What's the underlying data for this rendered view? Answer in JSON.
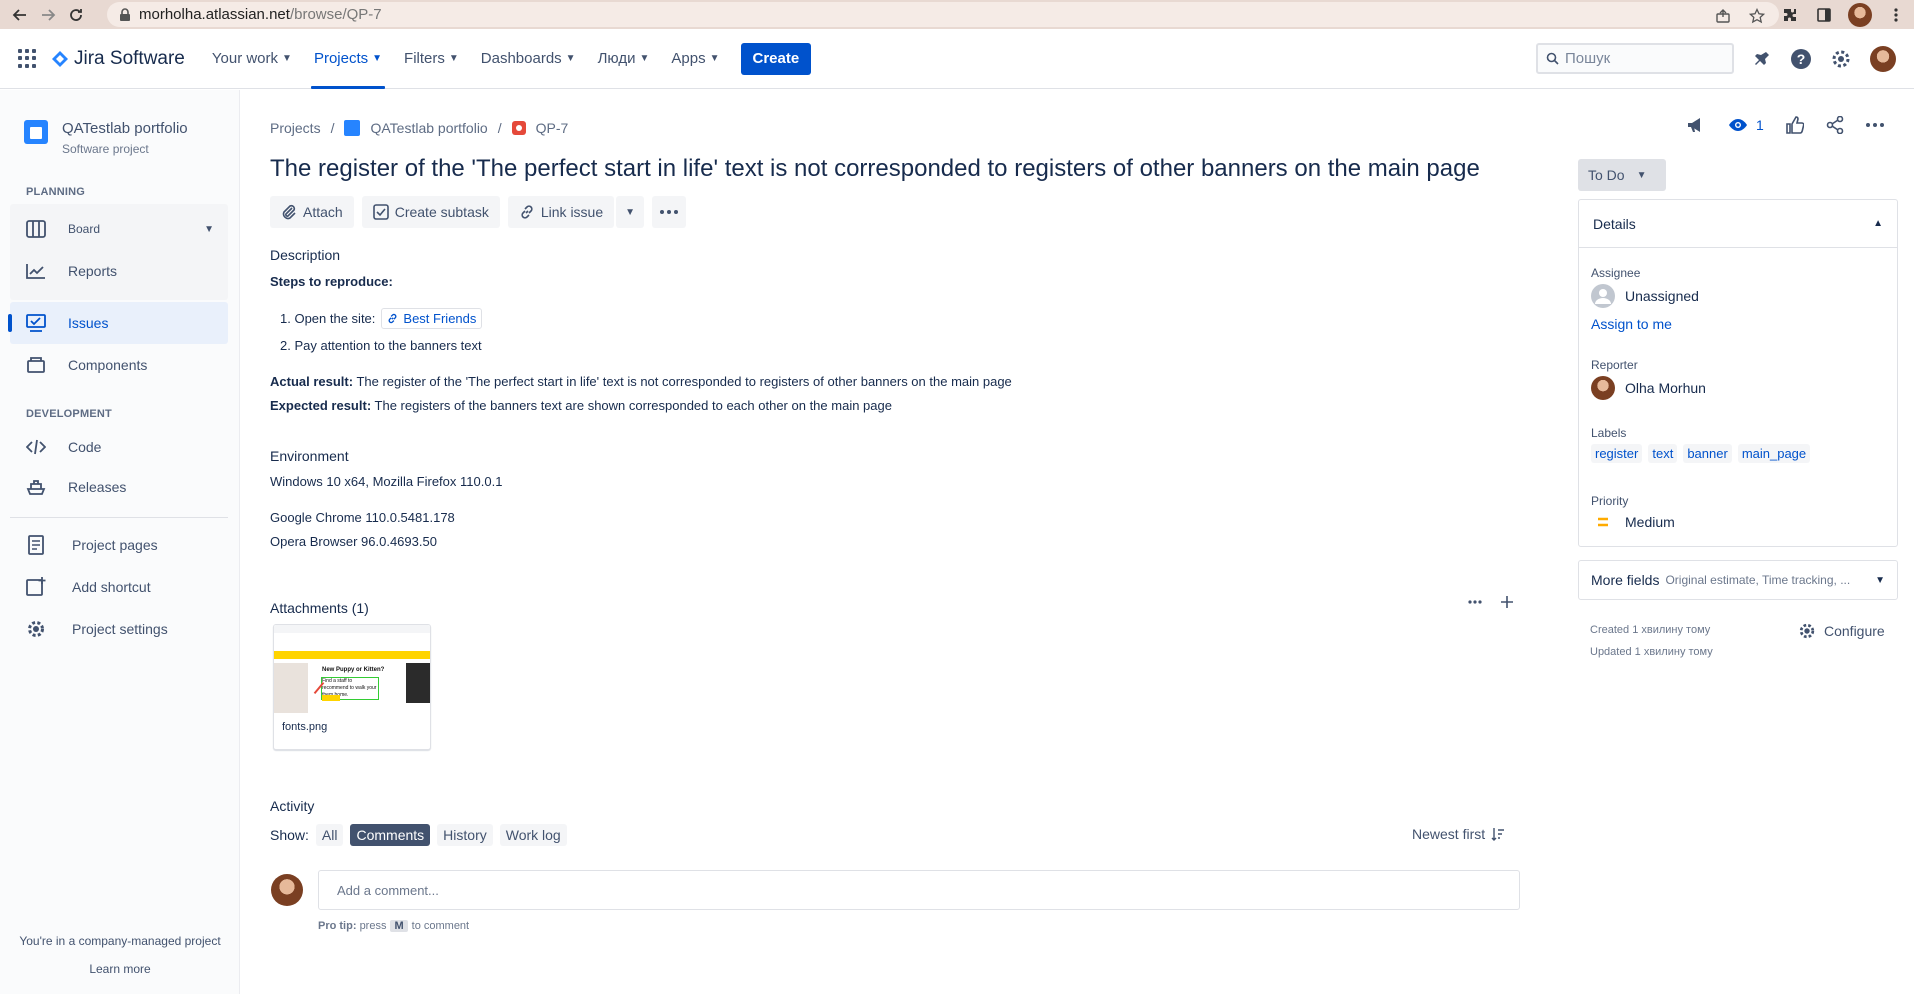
{
  "browser": {
    "url_host": "morholha.atlassian.net",
    "url_path": "/browse/QP-7"
  },
  "topnav": {
    "product": "Jira Software",
    "items": [
      {
        "label": "Your work"
      },
      {
        "label": "Projects"
      },
      {
        "label": "Filters"
      },
      {
        "label": "Dashboards"
      },
      {
        "label": "Люди"
      },
      {
        "label": "Apps"
      }
    ],
    "create_label": "Create",
    "search_placeholder": "Пошук"
  },
  "sidebar": {
    "project_name": "QATestlab portfolio",
    "project_type": "Software project",
    "planning_title": "PLANNING",
    "board": "Board",
    "reports": "Reports",
    "issues": "Issues",
    "components": "Components",
    "development_title": "DEVELOPMENT",
    "code": "Code",
    "releases": "Releases",
    "project_pages": "Project pages",
    "add_shortcut": "Add shortcut",
    "project_settings": "Project settings",
    "footer_note": "You're in a company-managed project",
    "learn_more": "Learn more"
  },
  "breadcrumb": {
    "projects": "Projects",
    "project": "QATestlab portfolio",
    "issue_key": "QP-7"
  },
  "issue": {
    "title": "The register of the 'The perfect start in life' text is not corresponded to registers of other banners on the main page",
    "toolbar": {
      "attach": "Attach",
      "create_subtask": "Create subtask",
      "link_issue": "Link issue"
    },
    "description_label": "Description",
    "steps_heading": "Steps to reproduce:",
    "step1_text": "1. Open the site:",
    "step1_link": "Best Friends",
    "step2_text": "2. Pay attention to the banners text",
    "actual_label": "Actual result:",
    "actual_text": " The register of the 'The perfect start in life' text is not corresponded to registers of other banners on the main page",
    "expected_label": "Expected result:",
    "expected_text": " The registers of the banners text are shown corresponded to each other on the main page",
    "environment_label": "Environment",
    "env_line1": "Windows 10 x64, Mozilla Firefox 110.0.1",
    "env_line2": "Google Chrome 110.0.5481.178",
    "env_line3": "Opera Browser 96.0.4693.50",
    "attachments_label": "Attachments (1)",
    "attachment_name": "fonts.png",
    "thumb_heading": "New Puppy or Kitten?",
    "thumb_sub": "Find a staff to recommend to walk your them home."
  },
  "activity": {
    "label": "Activity",
    "show_label": "Show:",
    "tabs": [
      {
        "label": "All"
      },
      {
        "label": "Comments"
      },
      {
        "label": "History"
      },
      {
        "label": "Work log"
      }
    ],
    "sort_label": "Newest first",
    "comment_placeholder": "Add a comment...",
    "pro_tip_label": "Pro tip:",
    "pro_tip_press": "press",
    "pro_tip_key": "M",
    "pro_tip_after": "to comment"
  },
  "right_panel": {
    "watch_count": "1",
    "status": "To Do",
    "details_title": "Details",
    "assignee_label": "Assignee",
    "assignee_value": "Unassigned",
    "assign_to_me": "Assign to me",
    "reporter_label": "Reporter",
    "reporter_value": "Olha Morhun",
    "labels_label": "Labels",
    "labels": [
      "register",
      "text",
      "banner",
      "main_page"
    ],
    "priority_label": "Priority",
    "priority_value": "Medium",
    "more_fields": "More fields",
    "more_fields_hint": "Original estimate, Time tracking, ...",
    "created": "Created 1 хвилину тому",
    "updated": "Updated 1 хвилину тому",
    "configure": "Configure"
  },
  "colors": {
    "brand": "#0052cc",
    "priority_medium": "#ffab00"
  }
}
